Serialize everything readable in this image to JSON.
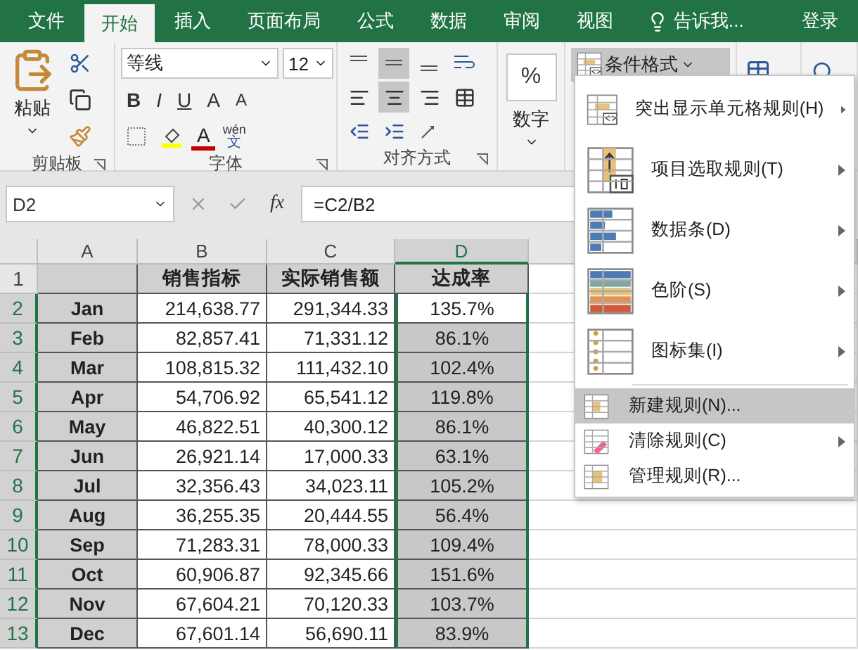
{
  "tabs": [
    {
      "label": "文件",
      "selected": false
    },
    {
      "label": "开始",
      "selected": true
    },
    {
      "label": "插入",
      "selected": false
    },
    {
      "label": "页面布局",
      "selected": false
    },
    {
      "label": "公式",
      "selected": false
    },
    {
      "label": "数据",
      "selected": false
    },
    {
      "label": "审阅",
      "selected": false
    },
    {
      "label": "视图",
      "selected": false
    }
  ],
  "tell_me": "告诉我...",
  "sign_in": "登录",
  "ribbon": {
    "clipboard": {
      "paste": "粘贴",
      "label": "剪贴板"
    },
    "font": {
      "name": "等线",
      "size": "12",
      "bold": "B",
      "italic": "I",
      "underline": "U",
      "grow": "A",
      "shrink": "A",
      "color_letter": "A",
      "phonetic_top": "wén",
      "phonetic_bottom": "文",
      "label": "字体"
    },
    "alignment": {
      "label": "对齐方式"
    },
    "number": {
      "symbol": "%",
      "label": "数字"
    },
    "conditional_format": {
      "label": "条件格式",
      "expanded": true
    }
  },
  "formula_bar": {
    "name_box": "D2",
    "fx": "fx",
    "formula": "=C2/B2"
  },
  "sheet": {
    "columns": [
      {
        "label": "A",
        "selected": false
      },
      {
        "label": "B",
        "selected": false
      },
      {
        "label": "C",
        "selected": false
      },
      {
        "label": "D",
        "selected": true
      }
    ],
    "header": {
      "number": "1",
      "selected": false,
      "target": "销售指标",
      "actual": "实际销售额",
      "rate": "达成率"
    },
    "rows": [
      {
        "number": "2",
        "selected": true,
        "active": true,
        "month": "Jan",
        "target": "214,638.77",
        "actual": "291,344.33",
        "rate": "135.7%"
      },
      {
        "number": "3",
        "selected": true,
        "active": false,
        "month": "Feb",
        "target": "82,857.41",
        "actual": "71,331.12",
        "rate": "86.1%"
      },
      {
        "number": "4",
        "selected": true,
        "active": false,
        "month": "Mar",
        "target": "108,815.32",
        "actual": "111,432.10",
        "rate": "102.4%"
      },
      {
        "number": "5",
        "selected": true,
        "active": false,
        "month": "Apr",
        "target": "54,706.92",
        "actual": "65,541.12",
        "rate": "119.8%"
      },
      {
        "number": "6",
        "selected": true,
        "active": false,
        "month": "May",
        "target": "46,822.51",
        "actual": "40,300.12",
        "rate": "86.1%"
      },
      {
        "number": "7",
        "selected": true,
        "active": false,
        "month": "Jun",
        "target": "26,921.14",
        "actual": "17,000.33",
        "rate": "63.1%"
      },
      {
        "number": "8",
        "selected": true,
        "active": false,
        "month": "Jul",
        "target": "32,356.43",
        "actual": "34,023.11",
        "rate": "105.2%"
      },
      {
        "number": "9",
        "selected": true,
        "active": false,
        "month": "Aug",
        "target": "36,255.35",
        "actual": "20,444.55",
        "rate": "56.4%"
      },
      {
        "number": "10",
        "selected": true,
        "active": false,
        "month": "Sep",
        "target": "71,283.31",
        "actual": "78,000.33",
        "rate": "109.4%"
      },
      {
        "number": "11",
        "selected": true,
        "active": false,
        "month": "Oct",
        "target": "60,906.87",
        "actual": "92,345.66",
        "rate": "151.6%"
      },
      {
        "number": "12",
        "selected": true,
        "active": false,
        "month": "Nov",
        "target": "67,604.21",
        "actual": "70,120.33",
        "rate": "103.7%"
      },
      {
        "number": "13",
        "selected": true,
        "active": false,
        "month": "Dec",
        "target": "67,601.14",
        "actual": "56,690.11",
        "rate": "83.9%"
      }
    ]
  },
  "menu": {
    "items": [
      {
        "kind": "large",
        "label": "突出显示单元格规则(H)",
        "submenu": true,
        "highlighted": false
      },
      {
        "kind": "large",
        "label": "项目选取规则(T)",
        "submenu": true,
        "highlighted": false
      },
      {
        "kind": "large",
        "label": "数据条(D)",
        "submenu": true,
        "highlighted": false
      },
      {
        "kind": "large",
        "label": "色阶(S)",
        "submenu": true,
        "highlighted": false
      },
      {
        "kind": "large",
        "label": "图标集(I)",
        "submenu": true,
        "highlighted": false
      },
      {
        "kind": "small",
        "label": "新建规则(N)...",
        "submenu": false,
        "highlighted": true
      },
      {
        "kind": "small",
        "label": "清除规则(C)",
        "submenu": true,
        "highlighted": false
      },
      {
        "kind": "small",
        "label": "管理规则(R)...",
        "submenu": false,
        "highlighted": false
      }
    ]
  }
}
